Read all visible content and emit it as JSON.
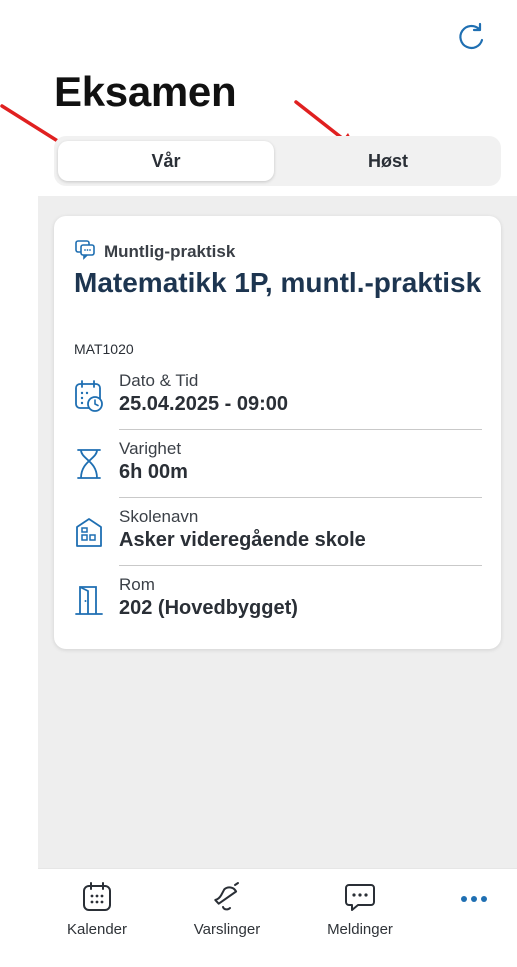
{
  "page": {
    "title": "Eksamen"
  },
  "segments": {
    "active": "Vår",
    "inactive": "Høst"
  },
  "exam": {
    "type": "Muntlig-praktisk",
    "title": "Matematikk 1P, muntl.-praktisk",
    "code": "MAT1020",
    "details": [
      {
        "label": "Dato & Tid",
        "value": "25.04.2025 - 09:00",
        "icon": "calendar-clock-icon"
      },
      {
        "label": "Varighet",
        "value": "6h 00m",
        "icon": "hourglass-icon"
      },
      {
        "label": "Skolenavn",
        "value": "Asker videregående skole",
        "icon": "school-building-icon"
      },
      {
        "label": "Rom",
        "value": "202 (Hovedbygget)",
        "icon": "door-icon"
      }
    ]
  },
  "tabs": [
    {
      "label": "Kalender",
      "icon": "calendar-icon"
    },
    {
      "label": "Varslinger",
      "icon": "bell-icon"
    },
    {
      "label": "Meldinger",
      "icon": "chat-icon"
    },
    {
      "label": "",
      "icon": "more-icon"
    }
  ],
  "colors": {
    "accent": "#1f6fb2",
    "title": "#1d3550",
    "annotation": "#e02020"
  }
}
